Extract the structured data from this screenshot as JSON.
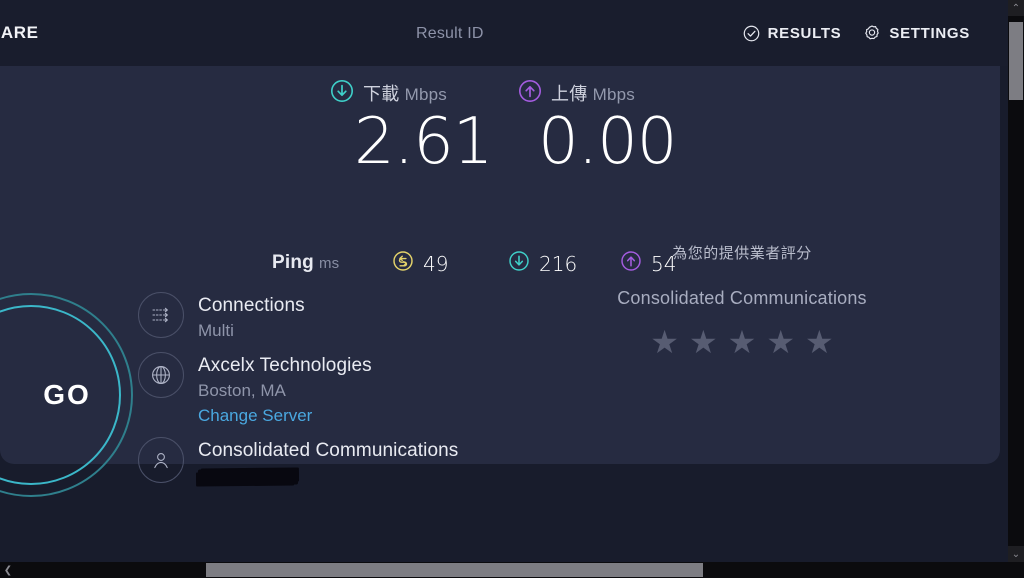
{
  "header": {
    "share_label": "HARE",
    "result_id_label": "Result ID",
    "results_label": "RESULTS",
    "settings_label": "SETTINGS",
    "results_icon": "check-circle-icon",
    "settings_icon": "gear-icon"
  },
  "speeds": {
    "download": {
      "label": "下載",
      "unit": "Mbps",
      "value": "2.61",
      "icon": "download-arrow-circle-icon",
      "color": "#3fd0c9"
    },
    "upload": {
      "label": "上傳",
      "unit": "Mbps",
      "value": "0.00",
      "icon": "upload-arrow-circle-icon",
      "color": "#a45ce0"
    }
  },
  "ping": {
    "title": "Ping",
    "unit": "ms",
    "idle": {
      "value": "49",
      "icon": "idle-latency-circle-icon",
      "color": "#e3d26a"
    },
    "download": {
      "value": "216",
      "icon": "download-arrow-circle-icon",
      "color": "#3fd0c9"
    },
    "upload": {
      "value": "54",
      "icon": "upload-arrow-circle-icon",
      "color": "#a45ce0"
    }
  },
  "go_button": {
    "label": "GO",
    "ring_color": "#3bb7c9"
  },
  "info": {
    "connections": {
      "icon": "multi-connections-icon",
      "primary": "Connections",
      "secondary": "Multi"
    },
    "server": {
      "icon": "globe-icon",
      "primary": "Axcelx Technologies",
      "secondary": "Boston, MA",
      "link": "Change Server"
    },
    "client": {
      "icon": "user-icon",
      "primary": "Consolidated Communications",
      "ip_redacted": ""
    }
  },
  "rating": {
    "title": "為您的提供業者評分",
    "provider": "Consolidated Communications",
    "stars": [
      "★",
      "★",
      "★",
      "★",
      "★"
    ],
    "filled_count": 0,
    "star_color": "#575c72"
  },
  "scrollbars": {
    "vertical_up": "⌃",
    "vertical_down": "⌄",
    "horizontal_left": "❮",
    "horizontal_right": "❯"
  }
}
